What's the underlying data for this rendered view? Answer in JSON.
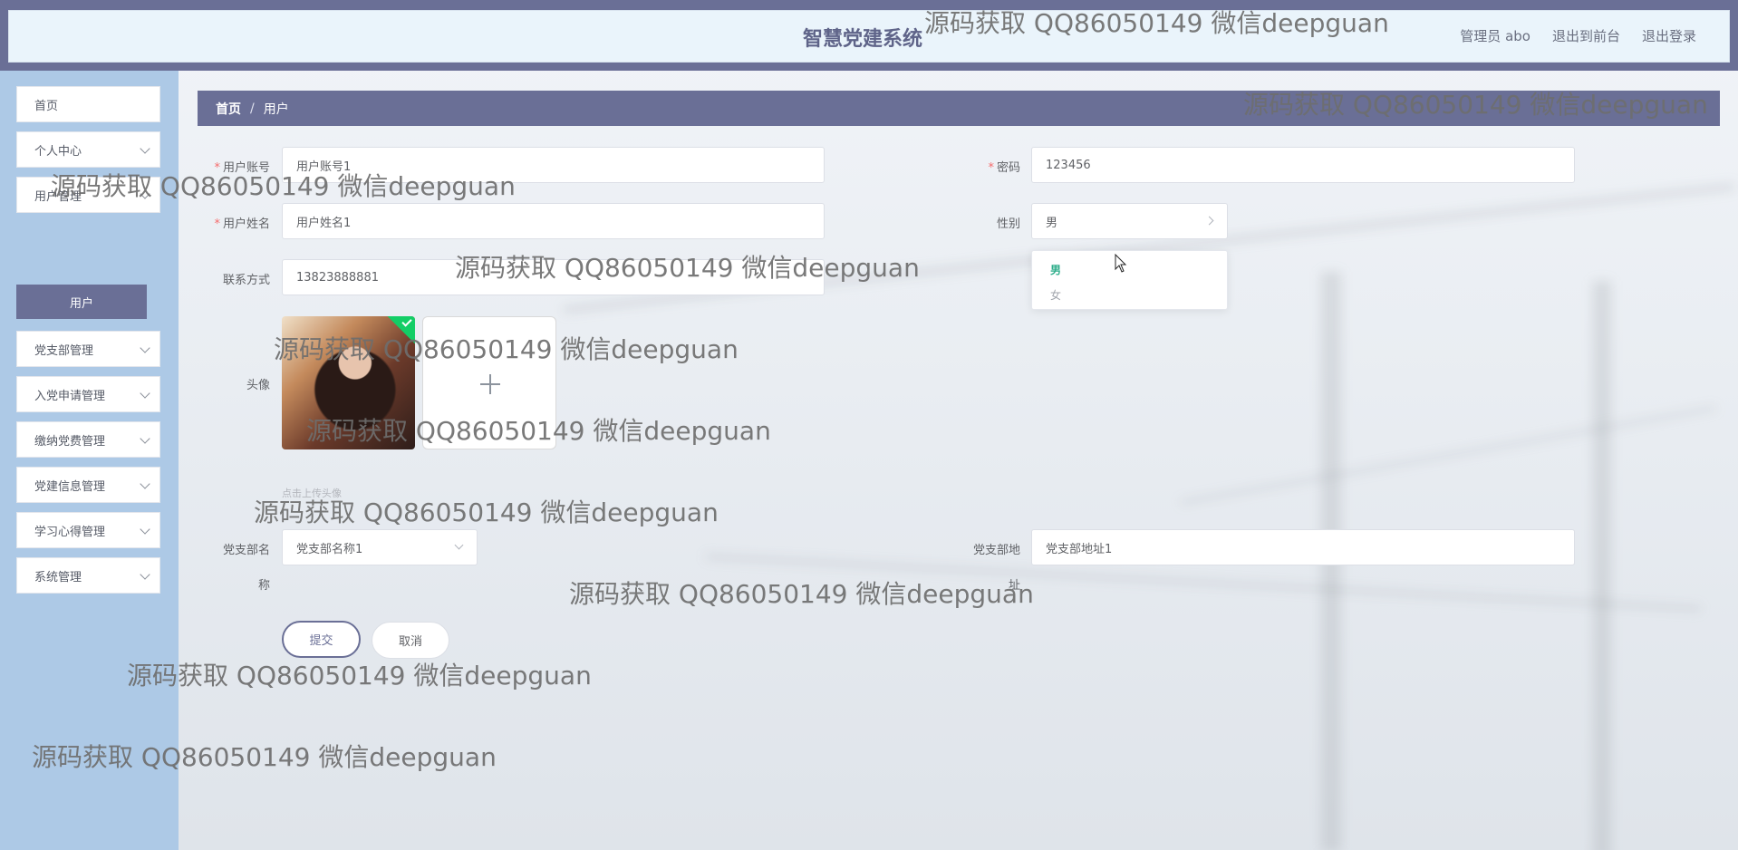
{
  "header": {
    "title": "智慧党建系统",
    "links": [
      "管理员 abo",
      "退出到前台",
      "退出登录"
    ]
  },
  "sidebar": {
    "items": [
      {
        "label": "首页",
        "has_arrow": false
      },
      {
        "label": "个人中心",
        "has_arrow": true
      },
      {
        "label": "用户管理",
        "has_arrow": true
      },
      {
        "label": "党支部管理",
        "has_arrow": true
      },
      {
        "label": "入党申请管理",
        "has_arrow": true
      },
      {
        "label": "缴纳党费管理",
        "has_arrow": true
      },
      {
        "label": "党建信息管理",
        "has_arrow": true
      },
      {
        "label": "学习心得管理",
        "has_arrow": true
      },
      {
        "label": "系统管理",
        "has_arrow": true
      }
    ],
    "active_sub": "用户"
  },
  "breadcrumb": {
    "home": "首页",
    "sep": "/",
    "current": "用户"
  },
  "form": {
    "account_label": "用户账号",
    "account_value": "用户账号1",
    "password_label": "密码",
    "password_value": "123456",
    "name_label": "用户姓名",
    "name_value": "用户姓名1",
    "gender_label": "性别",
    "gender_value": "男",
    "gender_options": [
      "男",
      "女"
    ],
    "phone_label": "联系方式",
    "phone_value": "13823888881",
    "avatar_label": "头像",
    "upload_hint": "点击上传头像",
    "branch_name_label_line1": "党支部名",
    "branch_name_label_line2": "称",
    "branch_name_value": "党支部名称1",
    "branch_addr_label_line1": "党支部地",
    "branch_addr_label_line2": "址",
    "branch_addr_value": "党支部地址1",
    "submit_label": "提交",
    "cancel_label": "取消"
  },
  "watermark": "源码获取 QQ86050149 微信deepguan",
  "colors": {
    "primary": "#6a6f96",
    "sidebar_bg": "#adc9e6",
    "header_bg": "#eaf4fb",
    "required": "#f56c6c",
    "option_selected": "#2fae8b",
    "upload_success": "#13ce66"
  }
}
